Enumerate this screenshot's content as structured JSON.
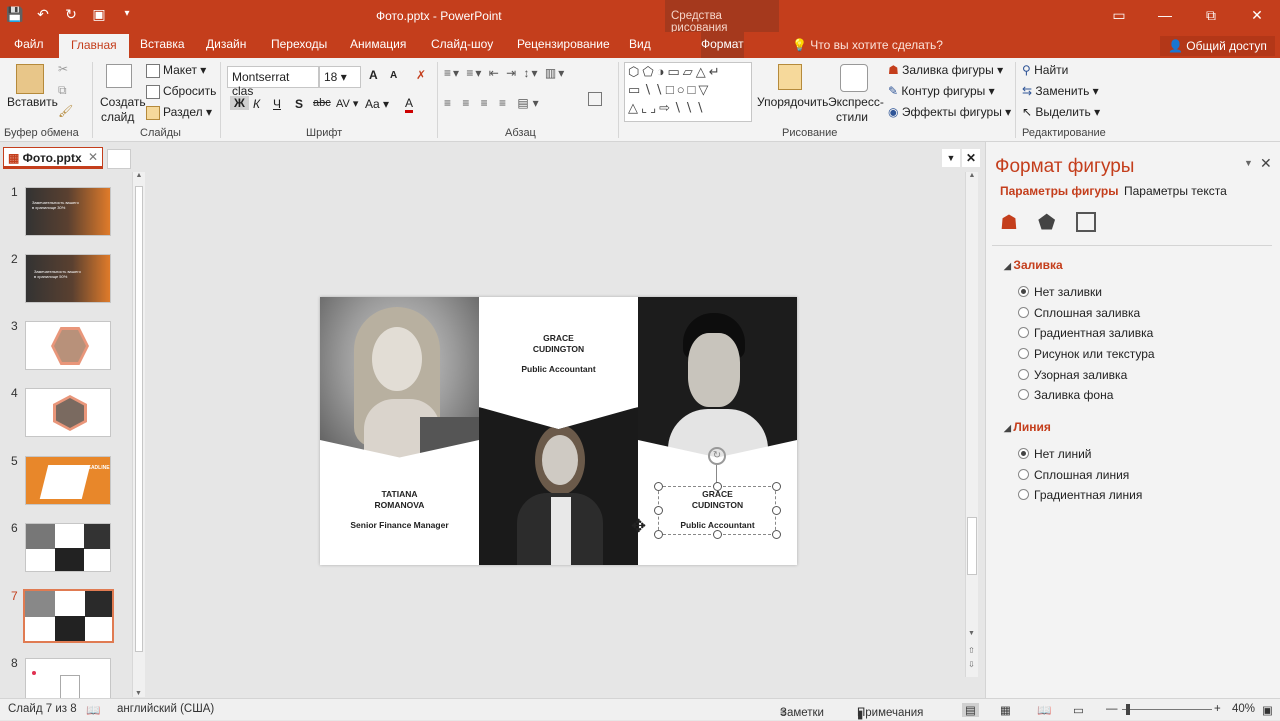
{
  "window": {
    "title": "Фото.pptx - PowerPoint",
    "context_group": "Средства рисования",
    "controls": [
      "minimize",
      "restore",
      "close"
    ]
  },
  "ribbon_tabs": [
    {
      "label": "Файл"
    },
    {
      "label": "Главная",
      "active": true
    },
    {
      "label": "Вставка"
    },
    {
      "label": "Дизайн"
    },
    {
      "label": "Переходы"
    },
    {
      "label": "Анимация"
    },
    {
      "label": "Слайд-шоу"
    },
    {
      "label": "Рецензирование"
    },
    {
      "label": "Вид"
    },
    {
      "label": "Формат"
    }
  ],
  "tell_me": "Что вы хотите сделать?",
  "share": "Общий доступ",
  "ribbon": {
    "clipboard": {
      "paste": "Вставить",
      "label": "Буфер обмена"
    },
    "slides": {
      "new_slide_1": "Создать",
      "new_slide_2": "слайд",
      "layout": "Макет",
      "reset": "Сбросить",
      "section": "Раздел",
      "label": "Слайды"
    },
    "font": {
      "name": "Montserrat clas",
      "size": "18",
      "bold": "Ж",
      "italic": "К",
      "underline": "Ч",
      "shadow": "S",
      "strike": "abc",
      "spacing": "AV",
      "case": "Aa",
      "color": "A",
      "grow": "A",
      "shrink": "A",
      "label": "Шрифт"
    },
    "paragraph": {
      "label": "Абзац"
    },
    "drawing": {
      "arrange": "Упорядочить",
      "quick_styles_1": "Экспресс-",
      "quick_styles_2": "стили",
      "fill": "Заливка фигуры",
      "outline": "Контур фигуры",
      "effects": "Эффекты фигуры",
      "label": "Рисование"
    },
    "editing": {
      "find": "Найти",
      "replace": "Заменить",
      "select": "Выделить",
      "label": "Редактирование"
    }
  },
  "doc_tab": "Фото.pptx",
  "thumbnails": [
    {
      "num": "1",
      "text": "Замечательность вашего в хранилище 30%"
    },
    {
      "num": "2",
      "text": "Замечательность вашего в хранилище 50%"
    },
    {
      "num": "3"
    },
    {
      "num": "4"
    },
    {
      "num": "5",
      "text": "HEADLINE"
    },
    {
      "num": "6"
    },
    {
      "num": "7",
      "selected": true
    },
    {
      "num": "8"
    }
  ],
  "slide": {
    "card_top": {
      "name_line1": "GRACE",
      "name_line2": "CUDINGTON",
      "role": "Public Accountant"
    },
    "card_left": {
      "name_line1": "TATIANA",
      "name_line2": "ROMANOVA",
      "role": "Senior Finance Manager"
    },
    "card_right": {
      "name_line1": "GRACE",
      "name_line2": "CUDINGTON",
      "role": "Public Accountant"
    }
  },
  "format_pane": {
    "title": "Формат фигуры",
    "tab_shape": "Параметры фигуры",
    "tab_text": "Параметры текста",
    "fill_section": "Заливка",
    "fill_options": [
      {
        "label": "Нет заливки",
        "checked": true
      },
      {
        "label": "Сплошная заливка"
      },
      {
        "label": "Градиентная заливка"
      },
      {
        "label": "Рисунок или текстура"
      },
      {
        "label": "Узорная заливка"
      },
      {
        "label": "Заливка фона"
      }
    ],
    "line_section": "Линия",
    "line_options": [
      {
        "label": "Нет линий",
        "checked": true
      },
      {
        "label": "Сплошная линия"
      },
      {
        "label": "Градиентная линия"
      }
    ]
  },
  "status": {
    "slide": "Слайд 7 из 8",
    "language": "английский (США)",
    "notes": "Заметки",
    "comments": "Примечания",
    "zoom": "40%"
  },
  "colors": {
    "accent": "#c43e1c",
    "context": "#a5391d"
  }
}
